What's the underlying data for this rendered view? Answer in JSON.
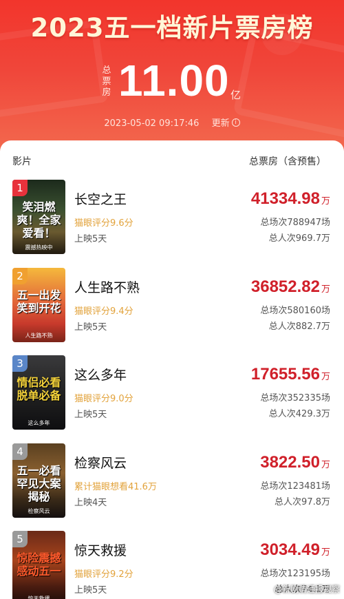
{
  "header": {
    "title": "2023五一档新片票房榜",
    "total_label": "总票房",
    "total_value": "11.00",
    "total_unit": "亿",
    "update_time": "2023-05-02  09:17:46",
    "refresh_label": "更新",
    "info_icon": "ⓘ"
  },
  "columns": {
    "film": "影片",
    "box_office": "总票房（含预售）"
  },
  "movies": [
    {
      "rank": "1",
      "rank_color": "#e8323c",
      "title": "长空之王",
      "rating": "猫眼评分9.6分",
      "days": "上映5天",
      "box_office": "41334.98",
      "unit": "万",
      "shows": "总场次788947场",
      "viewers": "总人次969.7万",
      "poster_text": "笑泪燃爽！全家爱看！",
      "poster_sub": "震撼热映中",
      "poster_bg": "linear-gradient(180deg,#1c2a1c 0%,#3a5030 40%,#6a5a30 70%,#201a10 100%)",
      "poster_text_color": "#ffffff"
    },
    {
      "rank": "2",
      "rank_color": "#f0a030",
      "title": "人生路不熟",
      "rating": "猫眼评分9.4分",
      "days": "上映5天",
      "box_office": "36852.82",
      "unit": "万",
      "shows": "总场次580160场",
      "viewers": "总人次882.7万",
      "poster_text": "五一出发笑到开花",
      "poster_sub": "人生路不熟",
      "poster_bg": "linear-gradient(180deg,#f5b93c 0%,#e2683a 45%,#c83a2c 75%,#7a2418 100%)",
      "poster_text_color": "#ffffff"
    },
    {
      "rank": "3",
      "rank_color": "#5a86c8",
      "title": "这么多年",
      "rating": "猫眼评分9.0分",
      "days": "上映5天",
      "box_office": "17655.56",
      "unit": "万",
      "shows": "总场次352335场",
      "viewers": "总人次429.3万",
      "poster_text": "情侣必看脱单必备",
      "poster_sub": "这么多年",
      "poster_bg": "linear-gradient(180deg,#3a3a3c 0%,#222 50%,#0e0e10 100%)",
      "poster_text_color": "#f4d23a"
    },
    {
      "rank": "4",
      "rank_color": "#9a9a9a",
      "title": "检察风云",
      "rating": "累计猫眼想看41.6万",
      "days": "上映4天",
      "box_office": "3822.50",
      "unit": "万",
      "shows": "总场次123481场",
      "viewers": "总人次97.8万",
      "poster_text": "五一必看罕见大案揭秘",
      "poster_sub": "检察风云",
      "poster_bg": "linear-gradient(180deg,#5a4020 0%,#8a6030 40%,#3a2a18 75%,#141010 100%)",
      "poster_text_color": "#ffffff"
    },
    {
      "rank": "5",
      "rank_color": "#9a9a9a",
      "title": "惊天救援",
      "rating": "猫眼评分9.2分",
      "days": "上映5天",
      "box_office": "3034.49",
      "unit": "万",
      "shows": "总场次123195场",
      "viewers": "总人次74.1万",
      "poster_text": "惊险震撼感动五一",
      "poster_sub": "惊天救援",
      "poster_bg": "linear-gradient(180deg,#6a2a18 0%,#a8441c 40%,#4a1c10 75%,#180a08 100%)",
      "poster_text_color": "#ff5a2c"
    }
  ],
  "watermark": "@新剧情通报视察"
}
